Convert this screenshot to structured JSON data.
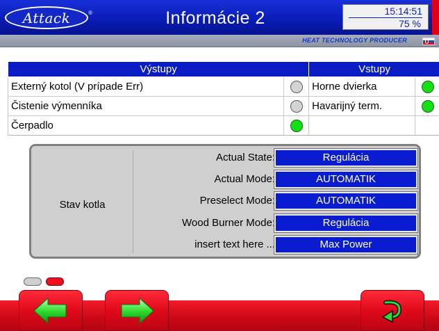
{
  "header": {
    "logo_text": "Attack",
    "logo_reg": "®",
    "title": "Informácie 2",
    "time": "15:14:51",
    "percent": "75  %",
    "producer": "HEAT TECHNOLOGY PRODUCER",
    "language_flag": "slovak-flag"
  },
  "io": {
    "outputs_header": "Výstupy",
    "inputs_header": "Vstupy",
    "outputs": [
      {
        "label": "Externý kotol (V prípade Err)",
        "state": "off"
      },
      {
        "label": "Čistenie výmenníka",
        "state": "off"
      },
      {
        "label": "Čerpadlo",
        "state": "on"
      }
    ],
    "inputs": [
      {
        "label": "Horne dvierka",
        "state": "on"
      },
      {
        "label": "Havarijný term.",
        "state": "on"
      }
    ]
  },
  "boiler": {
    "title": "Stav kotla",
    "rows": [
      {
        "label": "Actual State:",
        "value": "Regulácia"
      },
      {
        "label": "Actual Mode:",
        "value": "AUTOMATIK"
      },
      {
        "label": "Preselect Mode:",
        "value": "AUTOMATIK"
      },
      {
        "label": "Wood Burner Mode:",
        "value": "Regulácia"
      },
      {
        "label": "insert text here ...",
        "value": "Max Power"
      }
    ]
  },
  "pager": {
    "pages": 2,
    "active_page": 2
  },
  "footer": {
    "prev_icon": "arrow-left-icon",
    "next_icon": "arrow-right-icon",
    "back_icon": "return-arrow-icon"
  },
  "colors": {
    "header_blue": "#0a1cb8",
    "value_blue": "#0a1cd0",
    "footer_red": "#d00818",
    "lamp_on": "#12e012",
    "lamp_off": "#d4d4d4"
  }
}
